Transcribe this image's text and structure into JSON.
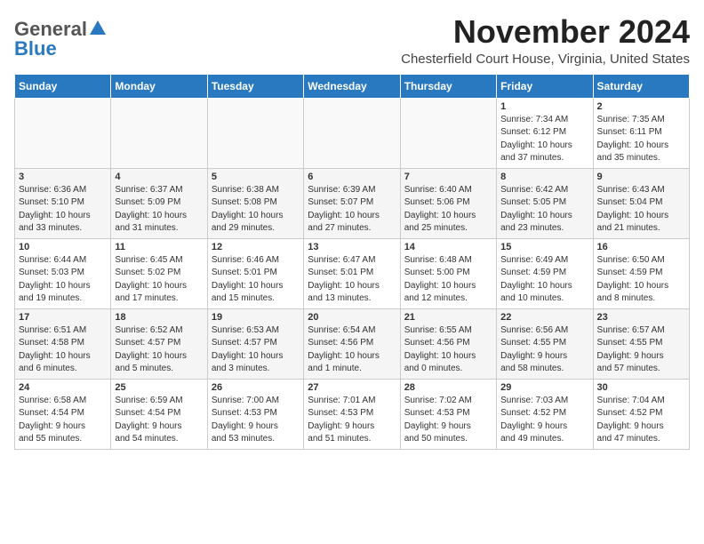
{
  "header": {
    "logo_general": "General",
    "logo_blue": "Blue",
    "month_title": "November 2024",
    "location": "Chesterfield Court House, Virginia, United States"
  },
  "weekdays": [
    "Sunday",
    "Monday",
    "Tuesday",
    "Wednesday",
    "Thursday",
    "Friday",
    "Saturday"
  ],
  "weeks": [
    [
      {
        "day": "",
        "info": ""
      },
      {
        "day": "",
        "info": ""
      },
      {
        "day": "",
        "info": ""
      },
      {
        "day": "",
        "info": ""
      },
      {
        "day": "",
        "info": ""
      },
      {
        "day": "1",
        "info": "Sunrise: 7:34 AM\nSunset: 6:12 PM\nDaylight: 10 hours\nand 37 minutes."
      },
      {
        "day": "2",
        "info": "Sunrise: 7:35 AM\nSunset: 6:11 PM\nDaylight: 10 hours\nand 35 minutes."
      }
    ],
    [
      {
        "day": "3",
        "info": "Sunrise: 6:36 AM\nSunset: 5:10 PM\nDaylight: 10 hours\nand 33 minutes."
      },
      {
        "day": "4",
        "info": "Sunrise: 6:37 AM\nSunset: 5:09 PM\nDaylight: 10 hours\nand 31 minutes."
      },
      {
        "day": "5",
        "info": "Sunrise: 6:38 AM\nSunset: 5:08 PM\nDaylight: 10 hours\nand 29 minutes."
      },
      {
        "day": "6",
        "info": "Sunrise: 6:39 AM\nSunset: 5:07 PM\nDaylight: 10 hours\nand 27 minutes."
      },
      {
        "day": "7",
        "info": "Sunrise: 6:40 AM\nSunset: 5:06 PM\nDaylight: 10 hours\nand 25 minutes."
      },
      {
        "day": "8",
        "info": "Sunrise: 6:42 AM\nSunset: 5:05 PM\nDaylight: 10 hours\nand 23 minutes."
      },
      {
        "day": "9",
        "info": "Sunrise: 6:43 AM\nSunset: 5:04 PM\nDaylight: 10 hours\nand 21 minutes."
      }
    ],
    [
      {
        "day": "10",
        "info": "Sunrise: 6:44 AM\nSunset: 5:03 PM\nDaylight: 10 hours\nand 19 minutes."
      },
      {
        "day": "11",
        "info": "Sunrise: 6:45 AM\nSunset: 5:02 PM\nDaylight: 10 hours\nand 17 minutes."
      },
      {
        "day": "12",
        "info": "Sunrise: 6:46 AM\nSunset: 5:01 PM\nDaylight: 10 hours\nand 15 minutes."
      },
      {
        "day": "13",
        "info": "Sunrise: 6:47 AM\nSunset: 5:01 PM\nDaylight: 10 hours\nand 13 minutes."
      },
      {
        "day": "14",
        "info": "Sunrise: 6:48 AM\nSunset: 5:00 PM\nDaylight: 10 hours\nand 12 minutes."
      },
      {
        "day": "15",
        "info": "Sunrise: 6:49 AM\nSunset: 4:59 PM\nDaylight: 10 hours\nand 10 minutes."
      },
      {
        "day": "16",
        "info": "Sunrise: 6:50 AM\nSunset: 4:59 PM\nDaylight: 10 hours\nand 8 minutes."
      }
    ],
    [
      {
        "day": "17",
        "info": "Sunrise: 6:51 AM\nSunset: 4:58 PM\nDaylight: 10 hours\nand 6 minutes."
      },
      {
        "day": "18",
        "info": "Sunrise: 6:52 AM\nSunset: 4:57 PM\nDaylight: 10 hours\nand 5 minutes."
      },
      {
        "day": "19",
        "info": "Sunrise: 6:53 AM\nSunset: 4:57 PM\nDaylight: 10 hours\nand 3 minutes."
      },
      {
        "day": "20",
        "info": "Sunrise: 6:54 AM\nSunset: 4:56 PM\nDaylight: 10 hours\nand 1 minute."
      },
      {
        "day": "21",
        "info": "Sunrise: 6:55 AM\nSunset: 4:56 PM\nDaylight: 10 hours\nand 0 minutes."
      },
      {
        "day": "22",
        "info": "Sunrise: 6:56 AM\nSunset: 4:55 PM\nDaylight: 9 hours\nand 58 minutes."
      },
      {
        "day": "23",
        "info": "Sunrise: 6:57 AM\nSunset: 4:55 PM\nDaylight: 9 hours\nand 57 minutes."
      }
    ],
    [
      {
        "day": "24",
        "info": "Sunrise: 6:58 AM\nSunset: 4:54 PM\nDaylight: 9 hours\nand 55 minutes."
      },
      {
        "day": "25",
        "info": "Sunrise: 6:59 AM\nSunset: 4:54 PM\nDaylight: 9 hours\nand 54 minutes."
      },
      {
        "day": "26",
        "info": "Sunrise: 7:00 AM\nSunset: 4:53 PM\nDaylight: 9 hours\nand 53 minutes."
      },
      {
        "day": "27",
        "info": "Sunrise: 7:01 AM\nSunset: 4:53 PM\nDaylight: 9 hours\nand 51 minutes."
      },
      {
        "day": "28",
        "info": "Sunrise: 7:02 AM\nSunset: 4:53 PM\nDaylight: 9 hours\nand 50 minutes."
      },
      {
        "day": "29",
        "info": "Sunrise: 7:03 AM\nSunset: 4:52 PM\nDaylight: 9 hours\nand 49 minutes."
      },
      {
        "day": "30",
        "info": "Sunrise: 7:04 AM\nSunset: 4:52 PM\nDaylight: 9 hours\nand 47 minutes."
      }
    ]
  ]
}
